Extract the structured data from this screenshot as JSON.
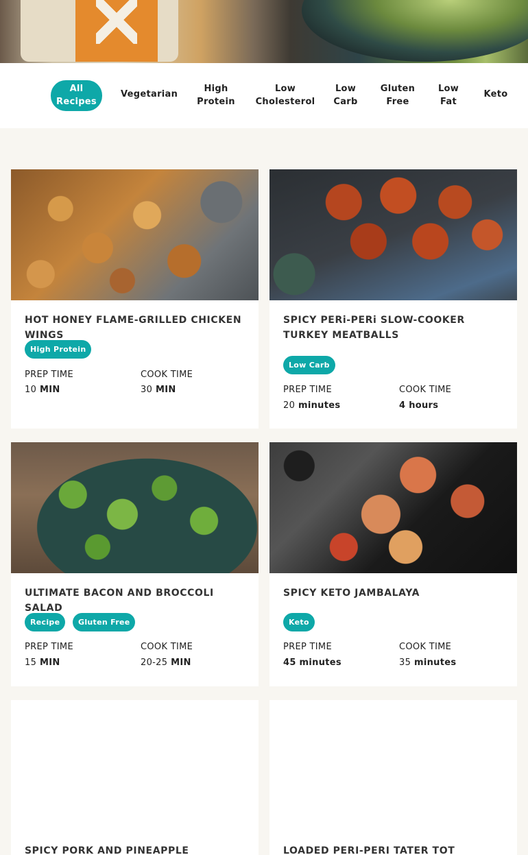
{
  "filters": [
    {
      "label": "All\nRecipes",
      "active": true
    },
    {
      "label": "Vegetarian",
      "active": false
    },
    {
      "label": "High\nProtein",
      "active": false
    },
    {
      "label": "Low\nCholesterol",
      "active": false
    },
    {
      "label": "Low\nCarb",
      "active": false
    },
    {
      "label": "Gluten\nFree",
      "active": false
    },
    {
      "label": "Low\nFat",
      "active": false
    },
    {
      "label": "Keto",
      "active": false
    }
  ],
  "colors": {
    "accent": "#0ea8a8",
    "page_bg": "#f8f6f1"
  },
  "recipes": [
    {
      "title": "HOT HONEY FLAME-GRILLED CHICKEN WINGS",
      "tags": [
        "High Protein"
      ],
      "prep_label": "PREP TIME",
      "prep_num": "10",
      "prep_unit": "MIN",
      "cook_label": "COOK TIME",
      "cook_num": "30",
      "cook_unit": "MIN"
    },
    {
      "title": "SPICY PERi-PERi SLOW-COOKER TURKEY MEATBALLS",
      "tags": [
        "Low Carb"
      ],
      "prep_label": "PREP TIME",
      "prep_num": "20",
      "prep_unit": "minutes",
      "cook_label": "COOK TIME",
      "cook_num": "4",
      "cook_unit": "hours"
    },
    {
      "title": "ULTIMATE BACON AND BROCCOLI SALAD",
      "tags": [
        "Recipe",
        "Gluten Free"
      ],
      "prep_label": "PREP TIME",
      "prep_num": "15",
      "prep_unit": "MIN",
      "cook_label": "COOK TIME",
      "cook_num": "20-25",
      "cook_unit": "MIN"
    },
    {
      "title": "SPICY KETO JAMBALAYA",
      "tags": [
        "Keto"
      ],
      "prep_label": "PREP TIME",
      "prep_num": "45",
      "prep_unit": "minutes",
      "cook_label": "COOK TIME",
      "cook_num": "35",
      "cook_unit": "minutes"
    },
    {
      "title": "SPICY PORK AND PINEAPPLE SKEWERS"
    },
    {
      "title": "LOADED PERI-PERI TATER TOT SKEWERS"
    }
  ]
}
